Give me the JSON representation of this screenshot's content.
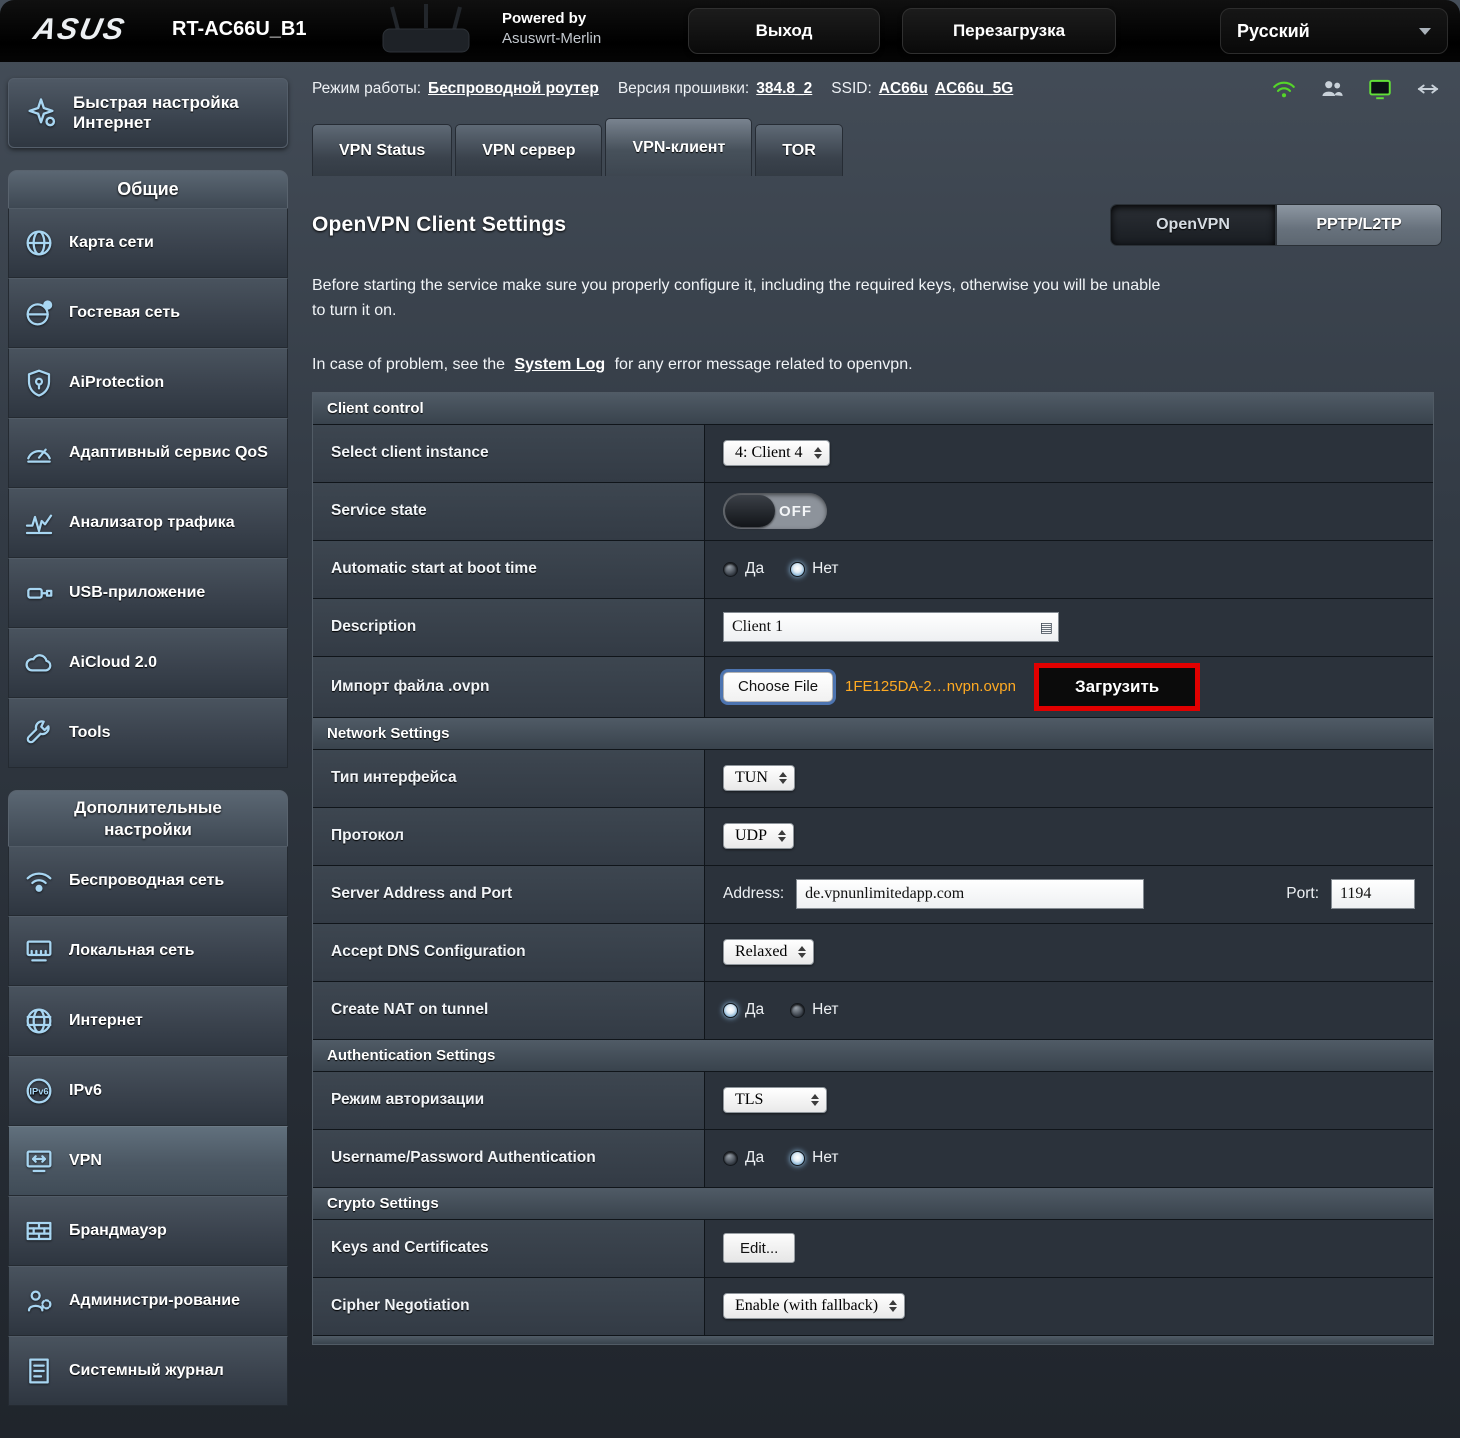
{
  "colors": {
    "accent_orange": "#ffaa22",
    "highlight_red": "#e10000",
    "wifi_green": "#55d629",
    "monitor_green": "#62df38",
    "icon_blue": "#a8d6f2"
  },
  "topbar": {
    "brand": "ASUS",
    "model": "RT-AC66U_B1",
    "powered_by": "Powered by",
    "firmware_name": "Asuswrt-Merlin",
    "logout_button": "Выход",
    "reboot_button": "Перезагрузка",
    "language": "Русский"
  },
  "infobar": {
    "mode_label": "Режим работы:",
    "mode_value": "Беспроводной роутер",
    "firmware_label": "Версия прошивки:",
    "firmware_value": "384.8_2",
    "ssid_label": "SSID:",
    "ssid_2g": "AC66u",
    "ssid_5g": "AC66u_5G"
  },
  "sidebar": {
    "quick_setup_line1": "Быстрая настройка",
    "quick_setup_line2": "Интернет",
    "section_general": "Общие",
    "general_items": [
      "Карта сети",
      "Гостевая сеть",
      "AiProtection",
      "Адаптивный сервис QoS",
      "Анализатор трафика",
      "USB-приложение",
      "AiCloud 2.0",
      "Tools"
    ],
    "section_advanced_line1": "Дополнительные",
    "section_advanced_line2": "настройки",
    "advanced_items": [
      "Беспроводная сеть",
      "Локальная сеть",
      "Интернет",
      "IPv6",
      "VPN",
      "Брандмауэр",
      "Администри-рование",
      "Системный журнал"
    ]
  },
  "tabs": [
    "VPN Status",
    "VPN сервер",
    "VPN-клиент",
    "TOR"
  ],
  "main": {
    "title": "OpenVPN Client Settings",
    "toggle_openvpn": "OpenVPN",
    "toggle_pptp": "PPTP/L2TP",
    "intro1": "Before starting the service make sure you properly configure it, including the required keys, otherwise you will be unable to turn it on.",
    "intro2_pre": "In case of problem, see the",
    "intro2_link": "System Log",
    "intro2_post": "for any error message related to openvpn."
  },
  "client_control": {
    "section_title": "Client control",
    "instance_label": "Select client instance",
    "instance_value": "4: Client 4",
    "state_label": "Service state",
    "state_value": "OFF",
    "autostart_label": "Automatic start at boot time",
    "radio_yes": "Да",
    "radio_no": "Нет",
    "description_label": "Description",
    "description_value": "Client 1",
    "import_label": "Импорт файла .ovpn",
    "choose_file": "Choose File",
    "file_name": "1FE125DA-2…nvpn.ovpn",
    "upload_button": "Загрузить"
  },
  "network": {
    "section_title": "Network Settings",
    "iface_label": "Тип интерфейса",
    "iface_value": "TUN",
    "proto_label": "Протокол",
    "proto_value": "UDP",
    "server_label": "Server Address and Port",
    "address_label": "Address:",
    "address_value": "de.vpnunlimitedapp.com",
    "port_label": "Port:",
    "port_value": "1194",
    "dns_label": "Accept DNS Configuration",
    "dns_value": "Relaxed",
    "nat_label": "Create NAT on tunnel",
    "radio_yes": "Да",
    "radio_no": "Нет"
  },
  "auth": {
    "section_title": "Authentication Settings",
    "mode_label": "Режим авторизации",
    "mode_value": "TLS",
    "userpass_label": "Username/Password Authentication",
    "radio_yes": "Да",
    "radio_no": "Нет"
  },
  "crypto": {
    "section_title": "Crypto Settings",
    "keys_label": "Keys and Certificates",
    "edit_button": "Edit...",
    "cipher_label": "Cipher Negotiation",
    "cipher_value": "Enable (with fallback)"
  }
}
